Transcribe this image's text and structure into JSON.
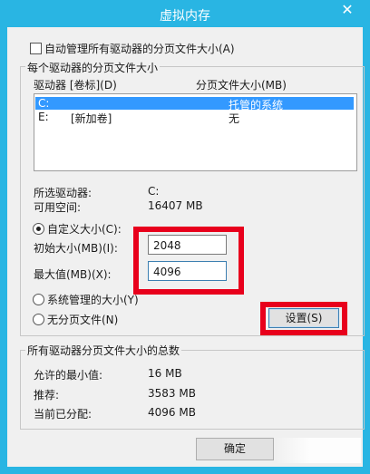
{
  "window": {
    "title": "虚拟内存",
    "close_glyph": "✕"
  },
  "auto_manage": {
    "label": "自动管理所有驱动器的分页文件大小(A)",
    "checked": false
  },
  "per_drive_group": {
    "title": "每个驱动器的分页文件大小",
    "columns": {
      "drive": "驱动器 [卷标](D)",
      "size": "分页文件大小(MB)"
    },
    "rows": [
      {
        "drive": "C:",
        "label": "",
        "size": "托管的系统",
        "selected": true
      },
      {
        "drive": "E:",
        "label": "[新加卷]",
        "size": "无",
        "selected": false
      }
    ],
    "selected_drive_label": "所选驱动器:",
    "selected_drive_value": "C:",
    "free_space_label": "可用空间:",
    "free_space_value": "16407 MB",
    "custom_size": {
      "label": "自定义大小(C):",
      "selected": true
    },
    "initial_size": {
      "label": "初始大小(MB)(I):",
      "value": "2048"
    },
    "max_size": {
      "label": "最大值(MB)(X):",
      "value": "4096"
    },
    "system_managed": {
      "label": "系统管理的大小(Y)",
      "selected": false
    },
    "no_paging_file": {
      "label": "无分页文件(N)",
      "selected": false
    },
    "set_button": "设置(S)"
  },
  "totals_group": {
    "title": "所有驱动器分页文件大小的总数",
    "min_allowed_label": "允许的最小值:",
    "min_allowed_value": "16 MB",
    "recommended_label": "推荐:",
    "recommended_value": "3583 MB",
    "currently_allocated_label": "当前已分配:",
    "currently_allocated_value": "4096 MB"
  },
  "ok_button": "确定",
  "colors": {
    "titlebar": "#29b5e3",
    "highlight_box": "#e8001c",
    "selection": "#3399ff"
  }
}
